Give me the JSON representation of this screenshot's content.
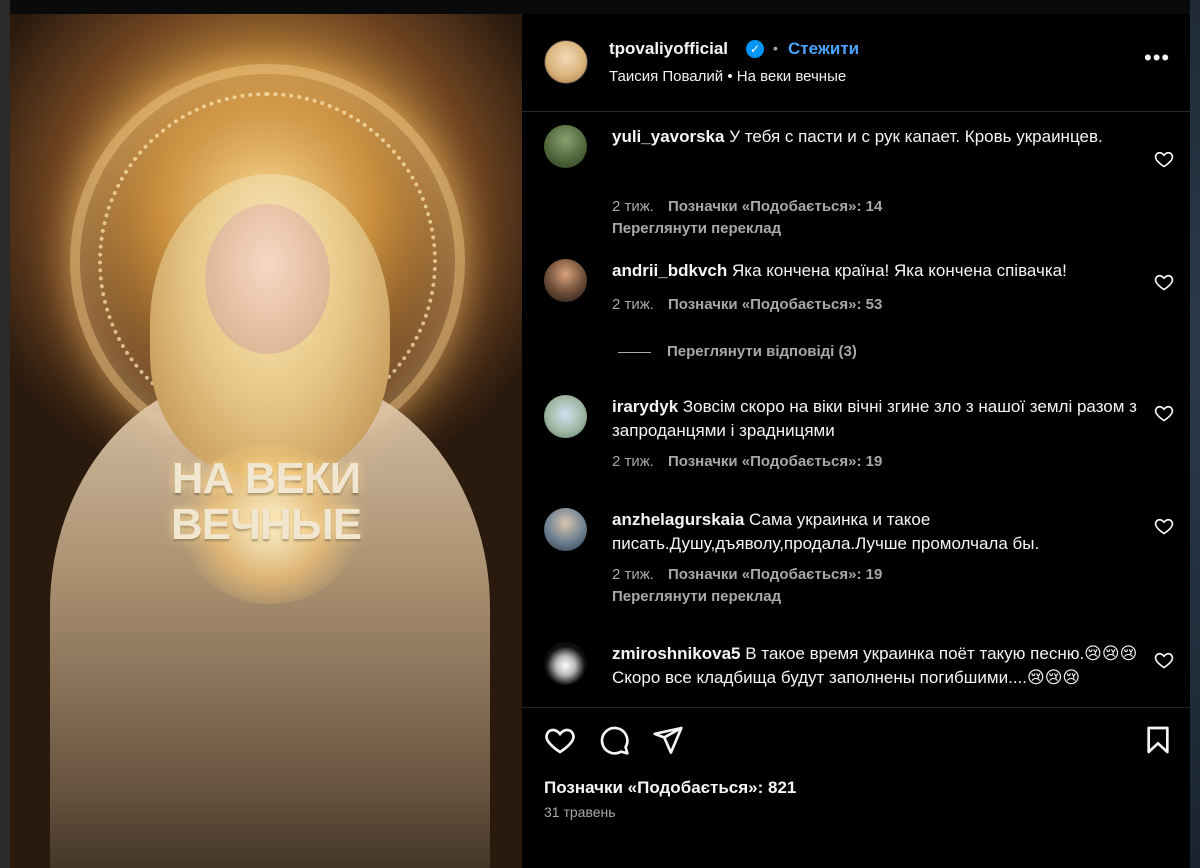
{
  "media": {
    "title_line1": "НА ВЕКИ",
    "title_line2": "ВЕЧНЫЕ"
  },
  "header": {
    "username": "tpovaliyofficial",
    "verified_badge": "✓",
    "separator": "•",
    "follow_label": "Стежити",
    "subtitle": "Таисия Повалий • На веки вечные",
    "more_label": "•••"
  },
  "comments": [
    {
      "username": "yuli_yavorska",
      "text": "У тебя с пасти и с рук капает. Кровь украинцев.",
      "time": "2 тиж.",
      "likes": "Позначки «Подобається»: 14",
      "translate": "Переглянути переклад"
    },
    {
      "username": "andrii_bdkvch",
      "text": "Яка кончена країна! Яка кончена співачка!",
      "time": "2 тиж.",
      "likes": "Позначки «Подобається»: 53",
      "replies": "Переглянути відповіді (3)"
    },
    {
      "username": "irarydyk",
      "text": "Зовсім скоро на віки вічні згине зло з нашої землі разом з запроданцями і зрадницями",
      "time": "2 тиж.",
      "likes": "Позначки «Подобається»: 19"
    },
    {
      "username": "anzhelagurskaia",
      "text": "Сама украинка и такое писать.Душу,дъяволу,продала.Лучше промолчала бы.",
      "time": "2 тиж.",
      "likes": "Позначки «Подобається»: 19",
      "translate": "Переглянути переклад"
    },
    {
      "username": "zmiroshnikova5",
      "text": "В такое время украинка поёт такую песню.😢😢😢Скоро все кладбища будут заполнены погибшими....😢😢😢"
    }
  ],
  "actions": {
    "likes_total": "Позначки «Подобається»: 821",
    "date": "31 травень"
  },
  "colors": {
    "accent": "#4aa3ff",
    "verified": "#0095f6",
    "muted": "#a8a8a8",
    "background": "#000000"
  }
}
